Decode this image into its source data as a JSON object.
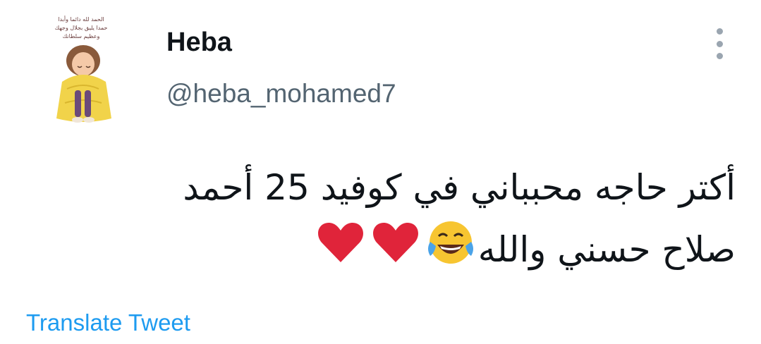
{
  "tweet": {
    "author": {
      "display_name": "Heba",
      "handle": "@heba_mohamed7",
      "avatar_caption_lines": [
        "الحمد لله دائما وأبدا",
        "حمدا يليق بجلال وجهك",
        "وعظيم سلطانك"
      ]
    },
    "text_line_1": "أكتر حاجه محبباني في كوفيد 25 أحمد",
    "text_line_2": "صلاح حسني والله",
    "emojis": [
      "face-with-tears-of-joy-icon",
      "red-heart-icon",
      "red-heart-icon"
    ],
    "more_menu_icon": "vertical-ellipsis-icon",
    "translate_label": "Translate Tweet"
  },
  "colors": {
    "name": "#0f1419",
    "handle": "#536471",
    "link": "#1d9bf0",
    "heart": "#e0243a",
    "dots": "#9aa5b0"
  }
}
